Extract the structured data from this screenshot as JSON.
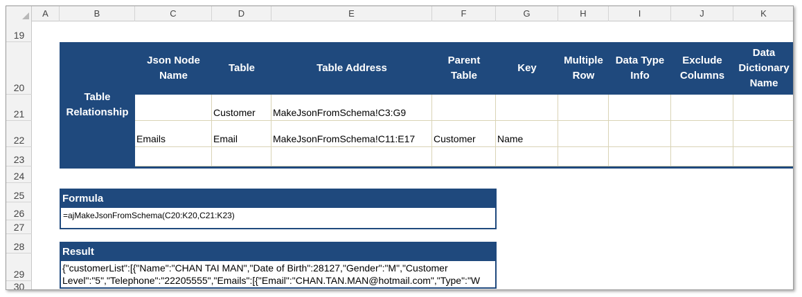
{
  "columns": [
    "A",
    "B",
    "C",
    "D",
    "E",
    "F",
    "G",
    "H",
    "I",
    "J",
    "K"
  ],
  "rows": [
    "19",
    "20",
    "21",
    "22",
    "23",
    "24",
    "25",
    "26",
    "27",
    "28",
    "29",
    "30"
  ],
  "relationship": {
    "label": "Table Relationship",
    "headers": [
      "Json Node Name",
      "Table",
      "Table Address",
      "Parent Table",
      "Key",
      "Multiple Row",
      "Data Type Info",
      "Exclude Columns",
      "Data Dictionary Name"
    ],
    "data": [
      [
        "",
        "Customer",
        "MakeJsonFromSchema!C3:G9",
        "",
        "",
        "",
        "",
        "",
        ""
      ],
      [
        "Emails",
        "Email",
        "MakeJsonFromSchema!C11:E17",
        "Customer",
        "Name",
        "",
        "",
        "",
        ""
      ],
      [
        "",
        "",
        "",
        "",
        "",
        "",
        "",
        "",
        ""
      ]
    ]
  },
  "formula": {
    "title": "Formula",
    "text": "=ajMakeJsonFromSchema(C20:K20,C21:K23)"
  },
  "result": {
    "title": "Result",
    "line1": "{\"customerList\":[{\"Name\":\"CHAN TAI MAN\",\"Date of Birth\":28127,\"Gender\":\"M\",\"Customer",
    "line2": "Level\":\"5\",\"Telephone\":\"22205555\",\"Emails\":[{\"Email\":\"CHAN.TAN.MAN@hotmail.com\",\"Type\":\"W"
  },
  "colors": {
    "header_fill": "#1f497d",
    "grid": "#d9d3b5"
  }
}
